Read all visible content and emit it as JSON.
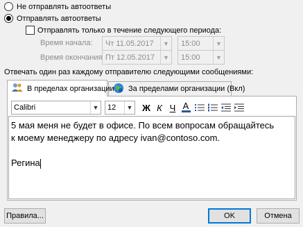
{
  "options": {
    "dont_send": "Не отправлять автоответы",
    "send": "Отправлять автоответы",
    "only_period": "Отправлять только в течение следующего периода:"
  },
  "period": {
    "start_label": "Время начала:",
    "start_date": "Чт 11.05.2017",
    "start_time": "15:00",
    "end_label": "Время окончания:",
    "end_date": "Пт 12.05.2017",
    "end_time": "15:00"
  },
  "reply_label": "Отвечать один раз каждому отправителю следующими сообщениями:",
  "tabs": [
    {
      "label": "В пределах организации"
    },
    {
      "label": "За пределами организации (Вкл)"
    }
  ],
  "toolbar": {
    "font": "Calibri",
    "size": "12",
    "bold": "Ж",
    "italic": "К",
    "underline": "Ч",
    "font_color": "A"
  },
  "message": {
    "line1": "5 мая меня не будет в офисе. По всем вопросам обращайтесь",
    "line2": "к моему менеджеру по адресу ivan@contoso.com.",
    "line3": "Регина"
  },
  "buttons": {
    "rules": "Правила...",
    "ok": "OK",
    "cancel": "Отмена"
  },
  "colors": {
    "accent": "#0078d7",
    "font_color_bar": "#2b579a"
  }
}
